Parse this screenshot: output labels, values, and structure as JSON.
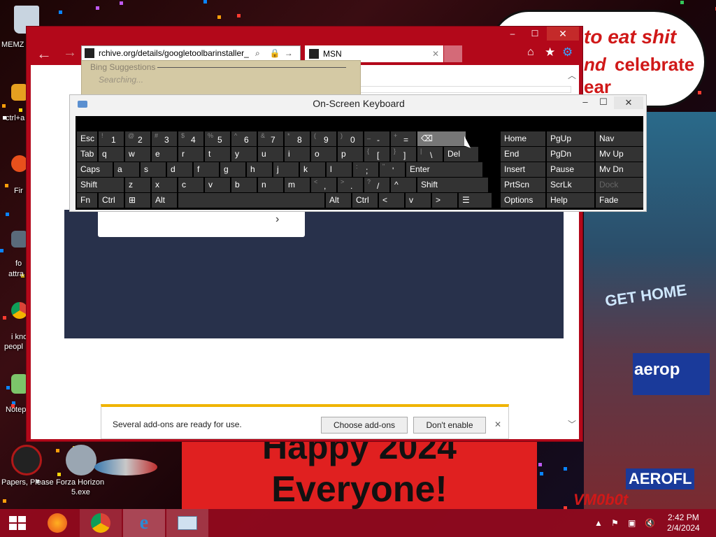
{
  "desktop": {
    "icons": [
      {
        "label": "MEMZ"
      },
      {
        "label": "ctrl+a"
      },
      {
        "label": "Fir"
      },
      {
        "label": "fo"
      },
      {
        "label": "attra"
      },
      {
        "label": "i kno"
      },
      {
        "label": "peopl"
      },
      {
        "label": "Notep"
      },
      {
        "label": "Papers, Please"
      },
      {
        "label": "Forza Horizon"
      },
      {
        "label": "5.exe"
      }
    ],
    "speech_bubble": {
      "line1": "to eat shit",
      "line2": "nd",
      "line3": "celebrate",
      "line4": "ear"
    },
    "banner": {
      "line1": "Happy 2024",
      "line2": "Everyone!"
    },
    "signs": {
      "get_home": "GET HOME",
      "aerop": "aerop",
      "aeroflot": "AEROFL",
      "vm0b0t": "VM0b0t"
    }
  },
  "browser": {
    "address": "rchive.org/details/googletoolbarinstaller_",
    "tab_title": "MSN",
    "bing_suggestions": "Bing Suggestions",
    "searching": "Searching...",
    "notification": {
      "message": "Several add-ons are ready for use.",
      "choose_label": "Choose add-ons",
      "dont_label": "Don't enable"
    }
  },
  "osk": {
    "title": "On-Screen Keyboard",
    "rows": [
      [
        {
          "t": "Esc"
        },
        {
          "t": "1",
          "s": "!"
        },
        {
          "t": "2",
          "s": "@"
        },
        {
          "t": "3",
          "s": "#"
        },
        {
          "t": "4",
          "s": "$"
        },
        {
          "t": "5",
          "s": "%"
        },
        {
          "t": "6",
          "s": "^"
        },
        {
          "t": "7",
          "s": "&"
        },
        {
          "t": "8",
          "s": "*"
        },
        {
          "t": "9",
          "s": "("
        },
        {
          "t": "0",
          "s": ")"
        },
        {
          "t": "-",
          "s": "_"
        },
        {
          "t": "=",
          "s": "+"
        },
        {
          "t": "⌫"
        }
      ],
      [
        {
          "t": "Tab"
        },
        {
          "t": "q"
        },
        {
          "t": "w"
        },
        {
          "t": "e"
        },
        {
          "t": "r"
        },
        {
          "t": "t"
        },
        {
          "t": "y"
        },
        {
          "t": "u"
        },
        {
          "t": "i"
        },
        {
          "t": "o"
        },
        {
          "t": "p"
        },
        {
          "t": "[",
          "s": "{"
        },
        {
          "t": "]",
          "s": "}"
        },
        {
          "t": "\\",
          "s": "|"
        },
        {
          "t": "Del"
        }
      ],
      [
        {
          "t": "Caps"
        },
        {
          "t": "a"
        },
        {
          "t": "s"
        },
        {
          "t": "d"
        },
        {
          "t": "f"
        },
        {
          "t": "g"
        },
        {
          "t": "h"
        },
        {
          "t": "j"
        },
        {
          "t": "k"
        },
        {
          "t": "l"
        },
        {
          "t": ";",
          "s": ":"
        },
        {
          "t": "'",
          "s": "\""
        },
        {
          "t": "Enter"
        }
      ],
      [
        {
          "t": "Shift"
        },
        {
          "t": "z"
        },
        {
          "t": "x"
        },
        {
          "t": "c"
        },
        {
          "t": "v"
        },
        {
          "t": "b"
        },
        {
          "t": "n"
        },
        {
          "t": "m"
        },
        {
          "t": ",",
          "s": "<"
        },
        {
          "t": ".",
          "s": ">"
        },
        {
          "t": "/",
          "s": "?"
        },
        {
          "t": "^"
        },
        {
          "t": "Shift"
        }
      ],
      [
        {
          "t": "Fn"
        },
        {
          "t": "Ctrl"
        },
        {
          "t": "⊞"
        },
        {
          "t": "Alt"
        },
        {
          "t": ""
        },
        {
          "t": "Alt"
        },
        {
          "t": "Ctrl"
        },
        {
          "t": "<"
        },
        {
          "t": "v"
        },
        {
          "t": ">"
        },
        {
          "t": "☰"
        }
      ]
    ],
    "nav": [
      [
        "Home",
        "PgUp",
        "Nav"
      ],
      [
        "End",
        "PgDn",
        "Mv Up"
      ],
      [
        "Insert",
        "Pause",
        "Mv Dn"
      ],
      [
        "PrtScn",
        "ScrLk",
        "Dock"
      ],
      [
        "Options",
        "Help",
        "Fade"
      ]
    ]
  },
  "taskbar": {
    "time": "2:42 PM",
    "date": "2/4/2024"
  }
}
